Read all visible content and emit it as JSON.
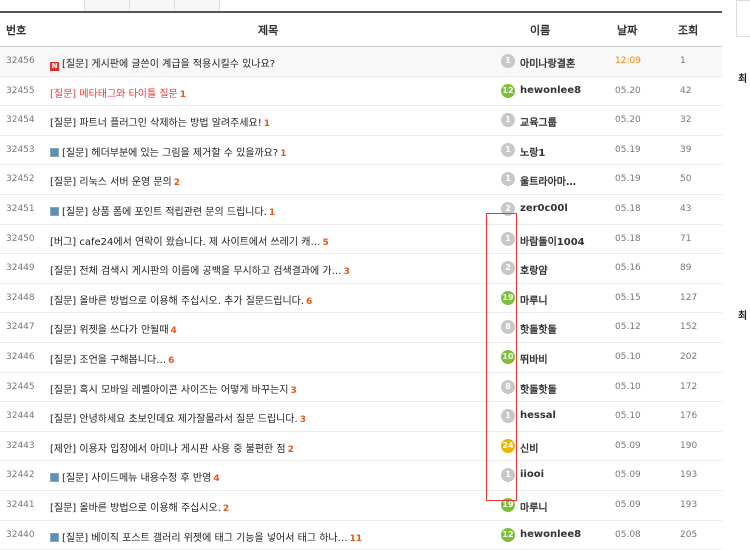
{
  "header": {
    "num": "번호",
    "title": "제목",
    "name": "이름",
    "date": "날짜",
    "views": "조회"
  },
  "rows": [
    {
      "num": "32456",
      "icon": "new",
      "title": "[질문] 게시판에 글쓴이 계급을 적용시킬수 있나요?",
      "comments": "",
      "level": "1",
      "level_color": "gray",
      "name": "아미나랑결혼",
      "date": "12:09",
      "date_color": "orange",
      "views": "1",
      "title_color": "dark"
    },
    {
      "num": "32455",
      "icon": "",
      "title": "[질문] 메타태그와 타이틀 질문",
      "comments": "1",
      "level": "12",
      "level_color": "green",
      "name": "hewonlee8",
      "date": "05.20",
      "views": "42",
      "title_color": "red"
    },
    {
      "num": "32454",
      "icon": "",
      "title": "[질문] 파트너 플러그인 삭제하는 방법 알려주세요!",
      "comments": "1",
      "level": "1",
      "level_color": "gray",
      "name": "교육그룹",
      "date": "05.20",
      "views": "32",
      "title_color": "dark"
    },
    {
      "num": "32453",
      "icon": "img",
      "title": "[질문] 헤더부분에 있는 그림을 제거할 수 있을까요?",
      "comments": "1",
      "level": "1",
      "level_color": "gray",
      "name": "노랑1",
      "date": "05.19",
      "views": "39",
      "title_color": "dark"
    },
    {
      "num": "32452",
      "icon": "",
      "title": "[질문] 리눅스 서버 운영 문의",
      "comments": "2",
      "level": "1",
      "level_color": "gray",
      "name": "울트라아마…",
      "date": "05.19",
      "views": "50",
      "title_color": "dark"
    },
    {
      "num": "32451",
      "icon": "img",
      "title": "[질문] 상품 폼에 포인트 적립관련 문의 드립니다.",
      "comments": "1",
      "level": "2",
      "level_color": "gray",
      "name": "zer0c00l",
      "date": "05.18",
      "views": "43",
      "title_color": "dark"
    },
    {
      "num": "32450",
      "icon": "",
      "title": "[버그] cafe24에서 연락이 왔습니다. 제 사이트에서 쓰레기 캐…",
      "comments": "5",
      "level": "1",
      "level_color": "gray",
      "name": "바람돌이1004",
      "date": "05.18",
      "views": "71",
      "title_color": "dark"
    },
    {
      "num": "32449",
      "icon": "",
      "title": "[질문] 전체 검색시 게시판의 이름에 공백을 무시하고 검색결과에 가…",
      "comments": "3",
      "level": "2",
      "level_color": "gray",
      "name": "호랑얌",
      "date": "05.16",
      "views": "89",
      "title_color": "dark"
    },
    {
      "num": "32448",
      "icon": "",
      "title": "[질문] 올바른 방법으로 이용해 주십시오. 추가 질문드립니다.",
      "comments": "6",
      "level": "19",
      "level_color": "green",
      "name": "마루니",
      "date": "05.15",
      "views": "127",
      "title_color": "dark"
    },
    {
      "num": "32447",
      "icon": "",
      "title": "[질문] 위젯을 쓰다가 안될때",
      "comments": "4",
      "level": "8",
      "level_color": "gray",
      "name": "핫돌핫돌",
      "date": "05.12",
      "views": "152",
      "title_color": "dark"
    },
    {
      "num": "32446",
      "icon": "",
      "title": "[질문] 조언을 구해봅니다…",
      "comments": "6",
      "level": "10",
      "level_color": "green",
      "name": "뛰바비",
      "date": "05.10",
      "views": "202",
      "title_color": "dark"
    },
    {
      "num": "32445",
      "icon": "",
      "title": "[질문] 혹시 모바일 레벨아이콘 사이즈는 어떻게 바꾸는지",
      "comments": "3",
      "level": "8",
      "level_color": "gray",
      "name": "핫돌핫돌",
      "date": "05.10",
      "views": "172",
      "title_color": "dark"
    },
    {
      "num": "32444",
      "icon": "",
      "title": "[질문] 안녕하세요 초보인데요 제가잘몰라서 질문 드립니다.",
      "comments": "3",
      "level": "1",
      "level_color": "gray",
      "name": "hessal",
      "date": "05.10",
      "views": "176",
      "title_color": "dark"
    },
    {
      "num": "32443",
      "icon": "",
      "title": "[제안] 이용자 입장에서 아미나 게시판 사용 중 불편한 점",
      "comments": "2",
      "level": "24",
      "level_color": "yellow",
      "name": "신비",
      "date": "05.09",
      "views": "190",
      "title_color": "dark"
    },
    {
      "num": "32442",
      "icon": "img",
      "title": "[질문] 사이드메뉴 내용수정 후 반영",
      "comments": "4",
      "level": "1",
      "level_color": "gray",
      "name": "iiooi",
      "date": "05.09",
      "views": "193",
      "title_color": "dark"
    },
    {
      "num": "32441",
      "icon": "",
      "title": "[질문] 올바른 방법으로 이용해 주십시오.",
      "comments": "2",
      "level": "19",
      "level_color": "green",
      "name": "마루니",
      "date": "05.09",
      "views": "193",
      "title_color": "dark"
    },
    {
      "num": "32440",
      "icon": "img",
      "title": "[질문] 베이직 포스트 갤러리 위젯에 태그 기능을 넣어서 태그 하나…",
      "comments": "11",
      "level": "12",
      "level_color": "green",
      "name": "hewonlee8",
      "date": "05.08",
      "views": "205",
      "title_color": "dark"
    }
  ],
  "side": {
    "section1": "최",
    "section2": "최"
  }
}
